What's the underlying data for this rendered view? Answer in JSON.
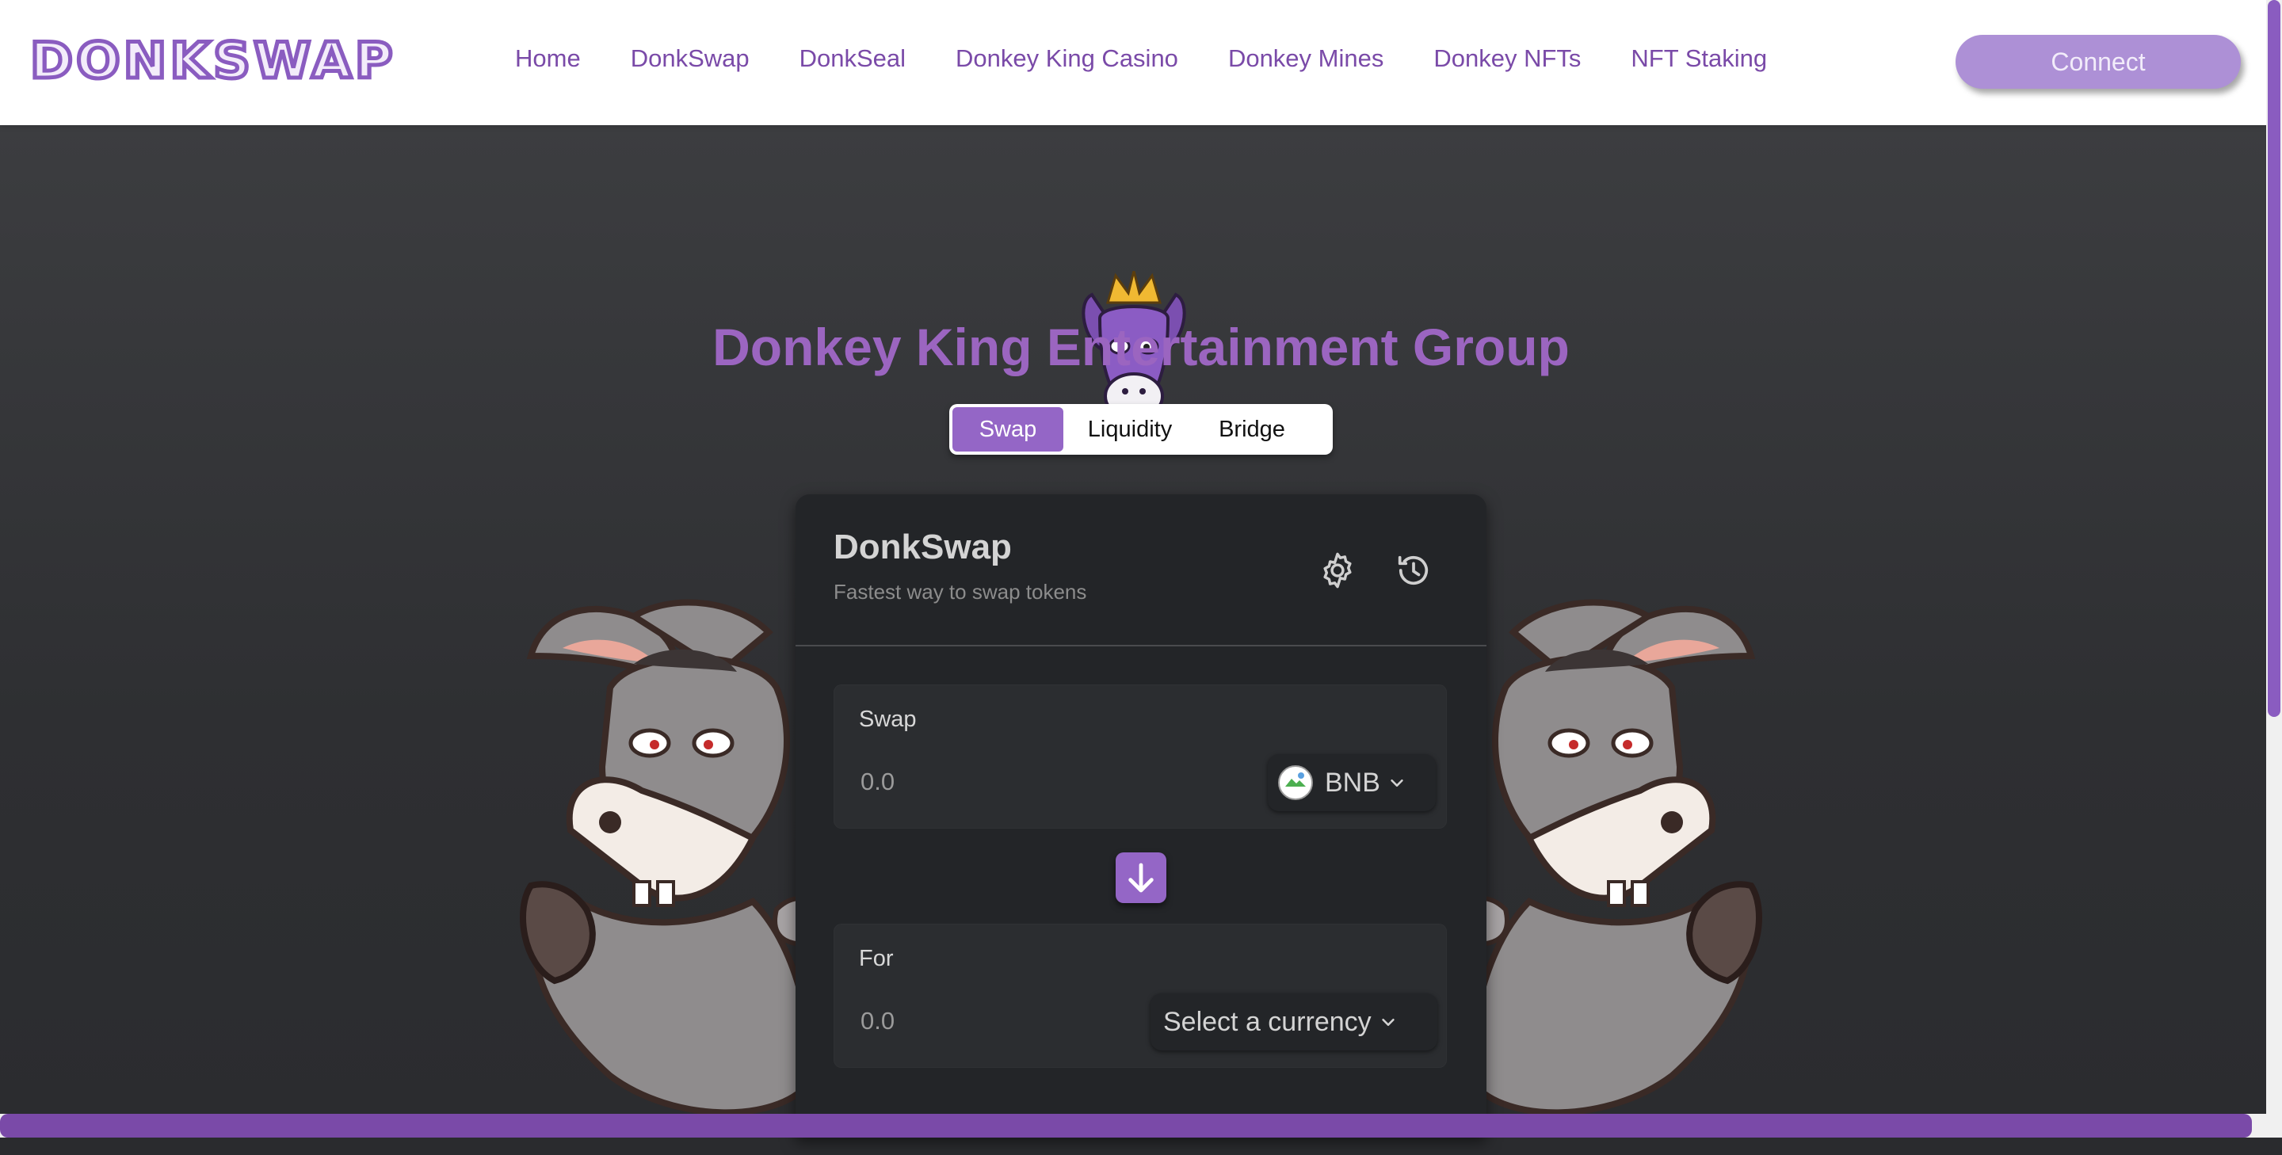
{
  "brand": {
    "logo_text": "DONKSWAP",
    "accent": "#8a5cc0",
    "title_color": "#9b65c0"
  },
  "nav": {
    "items": [
      "Home",
      "DonkSwap",
      "DonkSeal",
      "Donkey King Casino",
      "Donkey Mines",
      "Donkey NFTs",
      "NFT Staking"
    ],
    "connect_label": "Connect"
  },
  "hero": {
    "title": "Donkey King Entertainment Group",
    "mascot_icon": "crowned-donkey-logo"
  },
  "tabs": [
    "Swap",
    "Liquidity",
    "Bridge"
  ],
  "active_tab": "Swap",
  "card": {
    "title": "DonkSwap",
    "subtitle": "Fastest way to swap tokens",
    "settings_icon": "gear-icon",
    "history_icon": "history-icon",
    "swap_panel": {
      "label": "Swap",
      "placeholder": "0.0",
      "token": "BNB"
    },
    "arrow_icon": "arrow-down-icon",
    "for_panel": {
      "label": "For",
      "placeholder": "0.0",
      "token": "Select a currency"
    }
  }
}
